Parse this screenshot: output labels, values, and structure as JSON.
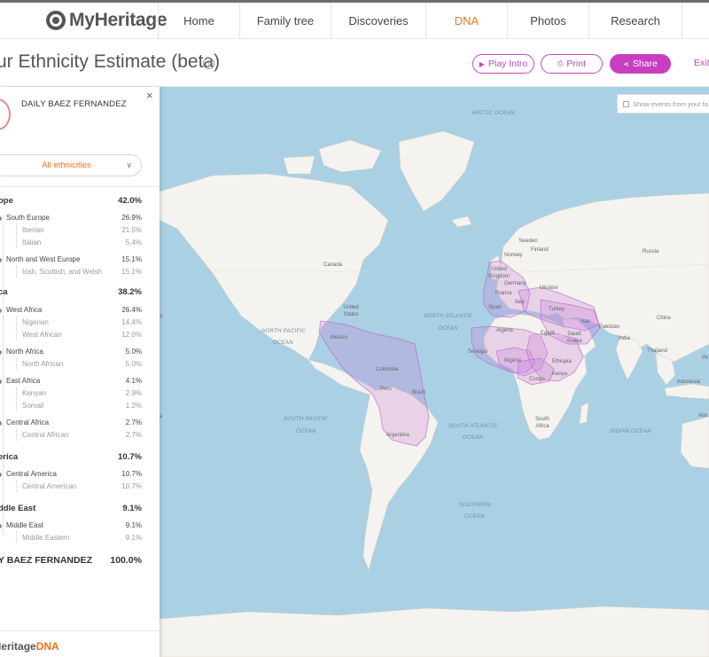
{
  "nav": {
    "logo": "MyHeritage",
    "items": [
      "Home",
      "Family tree",
      "Discoveries",
      "DNA",
      "Photos",
      "Research"
    ],
    "active": "DNA"
  },
  "header": {
    "title": "ur Ethnicity Estimate (beta)",
    "play_intro": "Play Intro",
    "print": "Print",
    "share": "Share",
    "exit": "Exit"
  },
  "sidebar": {
    "close": "×",
    "person_name": "DAILY BAEZ FERNANDEZ",
    "filter": "All ethnicities",
    "regions": [
      {
        "name": "ope",
        "pct": "42.0%"
      },
      {
        "name": "ca",
        "pct": "38.2%"
      },
      {
        "name": "erica",
        "pct": "10.7%"
      },
      {
        "name": "ddle East",
        "pct": "9.1%"
      }
    ],
    "subregions": [
      {
        "name": "South Europe",
        "pct": "26.9%"
      },
      {
        "name": "North and West Europe",
        "pct": "15.1%"
      },
      {
        "name": "West Africa",
        "pct": "26.4%"
      },
      {
        "name": "North Africa",
        "pct": "5.0%"
      },
      {
        "name": "East Africa",
        "pct": "4.1%"
      },
      {
        "name": "Central Africa",
        "pct": "2.7%"
      },
      {
        "name": "Central America",
        "pct": "10.7%"
      },
      {
        "name": "Middle East",
        "pct": "9.1%"
      }
    ],
    "ethnicities": [
      {
        "name": "Iberian",
        "pct": "21.5%"
      },
      {
        "name": "Italian",
        "pct": "5.4%"
      },
      {
        "name": "Irish, Scottish, and Welsh",
        "pct": "15.1%"
      },
      {
        "name": "Nigerian",
        "pct": "14.4%"
      },
      {
        "name": "West African",
        "pct": "12.0%"
      },
      {
        "name": "North African",
        "pct": "5.0%"
      },
      {
        "name": "Kenyan",
        "pct": "2.9%"
      },
      {
        "name": "Somali",
        "pct": "1.2%"
      },
      {
        "name": "Central African",
        "pct": "2.7%"
      },
      {
        "name": "Central American",
        "pct": "10.7%"
      },
      {
        "name": "Middle Eastern",
        "pct": "9.1%"
      }
    ],
    "total": {
      "name": "Y BAEZ FERNANDEZ",
      "pct": "100.0%"
    },
    "footer_logo": "yHeritage",
    "footer_dna": "DNA"
  },
  "map": {
    "show_events": "Show events from your fa",
    "oceans": [
      "ARCTIC OCEAN",
      "NORTH PACIFIC",
      "OCEAN",
      "NORTH ATLANTIC",
      "OCEAN",
      "SOUTH PACIFIC",
      "OCEAN",
      "SOUTH ATLANTIC",
      "OCEAN",
      "INDIAN OCEAN",
      "SOUTHERN",
      "OCEAN"
    ],
    "places": [
      "Canada",
      "United States",
      "Mexico",
      "Colombia",
      "Peru",
      "Brazil",
      "Argentina",
      "Sweden",
      "Norway",
      "Finland",
      "United Kingdom",
      "Germany",
      "France",
      "Ukraine",
      "Spain",
      "Italy",
      "Turkey",
      "Russia",
      "Algeria",
      "Egypt",
      "Saudi Arabia",
      "Iran",
      "Pakistan",
      "India",
      "China",
      "Thailand",
      "Indonesia",
      "Senegal",
      "Nigeria",
      "Ethiopia",
      "Kenya",
      "Congo",
      "South Africa",
      "Ph",
      "Aus",
      "Is",
      "a"
    ],
    "colors": {
      "highlight": "#c77dd6",
      "land": "#f5f3ef",
      "water": "#aad0e4",
      "accent": "#c73ec0",
      "orange": "#e8751a"
    }
  }
}
